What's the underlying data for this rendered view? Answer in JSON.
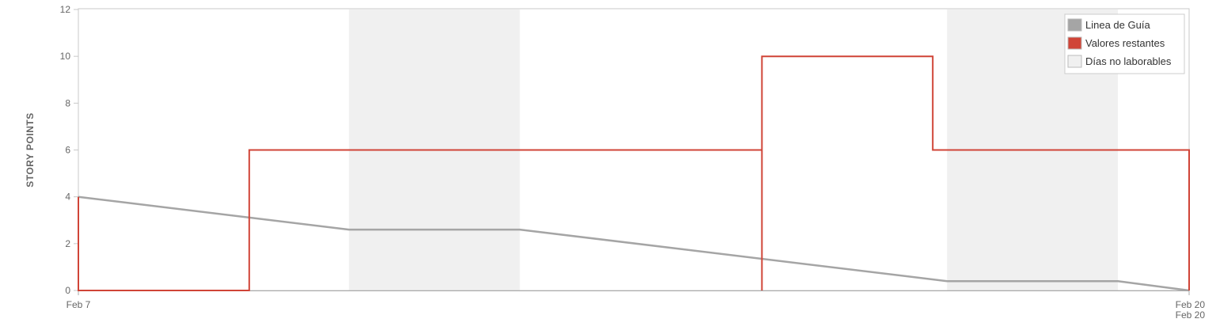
{
  "chart_data": {
    "type": "line",
    "title": "",
    "xlabel": "",
    "ylabel": "STORY POINTS",
    "ylim": [
      0,
      12
    ],
    "y_ticks": [
      0,
      2,
      4,
      6,
      8,
      10,
      12
    ],
    "x_range": [
      "2015-02-07",
      "2015-02-20"
    ],
    "x_tick_labels": [
      {
        "date": "2015-02-07",
        "lines": [
          "Feb 7"
        ]
      },
      {
        "date": "2015-02-20",
        "lines": [
          "Feb 20",
          "Feb 20"
        ]
      }
    ],
    "grid": false,
    "legend_position": "top-right",
    "non_working_days": [
      {
        "start": "2015-02-10T04:00",
        "end": "2015-02-12T04:00"
      },
      {
        "start": "2015-02-17T04:00",
        "end": "2015-02-19T04:00"
      }
    ],
    "series": [
      {
        "name": "Linea de Guía",
        "color": "#a5a5a5",
        "step": false,
        "points": [
          {
            "x": "2015-02-07T00:00",
            "y": 4
          },
          {
            "x": "2015-02-10T04:00",
            "y": 2.6
          },
          {
            "x": "2015-02-12T04:00",
            "y": 2.6
          },
          {
            "x": "2015-02-17T04:00",
            "y": 0.4
          },
          {
            "x": "2015-02-19T04:00",
            "y": 0.4
          },
          {
            "x": "2015-02-20T00:00",
            "y": 0
          }
        ]
      },
      {
        "name": "Valores restantes",
        "color": "#d04437",
        "step": true,
        "points": [
          {
            "x": "2015-02-07T00:00",
            "y": 4
          },
          {
            "x": "2015-02-07T00:00",
            "y": 0
          },
          {
            "x": "2015-02-09T00:00",
            "y": 0
          },
          {
            "x": "2015-02-09T00:00",
            "y": 6
          },
          {
            "x": "2015-02-15T00:00",
            "y": 6
          },
          {
            "x": "2015-02-15T00:00",
            "y": 0
          },
          {
            "x": "2015-02-15T00:00",
            "y": 4
          },
          {
            "x": "2015-02-15T00:00",
            "y": 10
          },
          {
            "x": "2015-02-17T00:00",
            "y": 10
          },
          {
            "x": "2015-02-17T00:00",
            "y": 6
          },
          {
            "x": "2015-02-20T00:00",
            "y": 6
          },
          {
            "x": "2015-02-20T00:00",
            "y": 0
          }
        ]
      }
    ],
    "legend": [
      {
        "label": "Linea de Guía",
        "color": "#a5a5a5"
      },
      {
        "label": "Valores restantes",
        "color": "#d04437"
      },
      {
        "label": "Días no laborables",
        "color": "#f0f0f0"
      }
    ]
  }
}
